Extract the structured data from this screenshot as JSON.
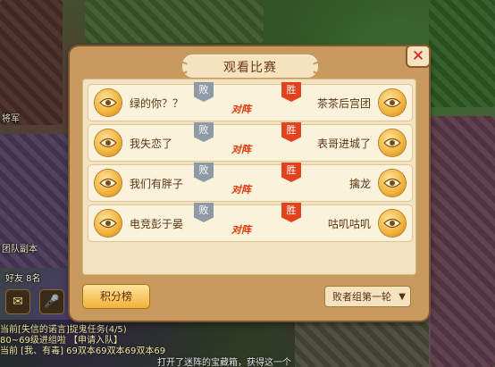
{
  "modal": {
    "title": "观看比赛",
    "close_symbol": "✕",
    "matches": [
      {
        "left_player": "绿的你？？",
        "right_player": "茶茶后宫团",
        "lose_flag": "败",
        "win_flag": "胜",
        "vs_label": "对阵"
      },
      {
        "left_player": "我失恋了",
        "right_player": "表哥进城了",
        "lose_flag": "败",
        "win_flag": "胜",
        "vs_label": "对阵"
      },
      {
        "left_player": "我们有胖子",
        "right_player": "擒龙",
        "lose_flag": "败",
        "win_flag": "胜",
        "vs_label": "对阵"
      },
      {
        "left_player": "电竞彭于晏",
        "right_player": "咕叽咕叽",
        "lose_flag": "败",
        "win_flag": "胜",
        "vs_label": "对阵"
      }
    ],
    "rank_button": "积分榜",
    "round_select": "败者组第一轮"
  },
  "background": {
    "label_left_1": "将军",
    "label_left_2": "团队副本",
    "label_left_3": "好友 8名",
    "chat_lines": [
      "当前[失信的诺言]捉鬼任务(4/5)",
      "80~69级进组啦 【申请入队】",
      "当前 [我、有毒] 69双本69双本69双本69",
      "打开了迷阵的宝藏箱，获得这一个"
    ]
  },
  "colors": {
    "panel": "#c89a5e",
    "panel_inner": "#f2e2c2",
    "row": "#fbf2dc",
    "win_flag": "#e2421e",
    "lose_flag": "#8e9aa6",
    "vs_text": "#e13a1a",
    "close_x": "#d61e1e"
  },
  "icons": {
    "watch": "eye-icon",
    "close": "close-icon",
    "select": "chevron-down-icon"
  }
}
